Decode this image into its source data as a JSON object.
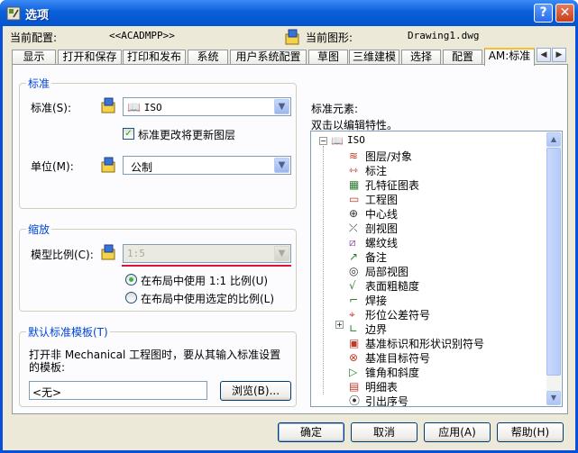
{
  "window": {
    "title": "选项"
  },
  "header": {
    "profile_label": "当前配置:",
    "profile_value": "<<ACADMPP>>",
    "drawing_label": "当前图形:",
    "drawing_value": "Drawing1.dwg"
  },
  "tabs": [
    "显示",
    "打开和保存",
    "打印和发布",
    "系统",
    "用户系统配置",
    "草图",
    "三维建模",
    "选择",
    "配置",
    "AM:标准"
  ],
  "active_tab": "AM:标准",
  "standard_group": {
    "title": "标准",
    "standard_label": "标准(S):",
    "standard_value": "ISO",
    "update_layers_label": "标准更改将更新图层",
    "update_layers_checked": true,
    "units_label": "单位(M):",
    "units_value": "公制"
  },
  "scale_group": {
    "title": "缩放",
    "model_scale_label": "模型比例(C):",
    "model_scale_value": "1:5",
    "radio_1_label": "在布局中使用 1:1 比例(U)",
    "radio_2_label": "在布局中使用选定的比例(L)",
    "selected_radio": 1
  },
  "template_group": {
    "title": "默认标准模板(T)",
    "description": "打开非 Mechanical 工程图时，要从其输入标准设置的模板:",
    "template_value": "<无>",
    "browse_label": "浏览(B)..."
  },
  "elements": {
    "title": "标准元素:",
    "subtitle": "双击以编辑特性。",
    "root": "ISO",
    "items": [
      {
        "label": "图层/对象",
        "icon": "layers-icon"
      },
      {
        "label": "标注",
        "icon": "dimension-icon"
      },
      {
        "label": "孔特征图表",
        "icon": "hole-chart-icon"
      },
      {
        "label": "工程图",
        "icon": "drawing-view-icon"
      },
      {
        "label": "中心线",
        "icon": "centerline-icon"
      },
      {
        "label": "剖视图",
        "icon": "section-view-icon"
      },
      {
        "label": "螺纹线",
        "icon": "thread-icon"
      },
      {
        "label": "备注",
        "icon": "note-icon"
      },
      {
        "label": "局部视图",
        "icon": "detail-view-icon"
      },
      {
        "label": "表面粗糙度",
        "icon": "surface-texture-icon"
      },
      {
        "label": "焊接",
        "icon": "weld-icon"
      },
      {
        "label": "形位公差符号",
        "icon": "fcf-icon"
      },
      {
        "label": "边界",
        "icon": "edge-icon"
      },
      {
        "label": "基准标识和形状识别符号",
        "icon": "datum-id-icon"
      },
      {
        "label": "基准目标符号",
        "icon": "datum-target-icon"
      },
      {
        "label": "锥角和斜度",
        "icon": "taper-icon"
      },
      {
        "label": "明细表",
        "icon": "bom-icon"
      },
      {
        "label": "引出序号",
        "icon": "balloon-icon"
      }
    ]
  },
  "buttons": {
    "ok": "确定",
    "cancel": "取消",
    "apply": "应用(A)",
    "help": "帮助(H)"
  },
  "colors": {
    "accent_blue": "#0046d5",
    "titlebar": "#0a5fd8",
    "annotation_red": "#e0103c"
  }
}
